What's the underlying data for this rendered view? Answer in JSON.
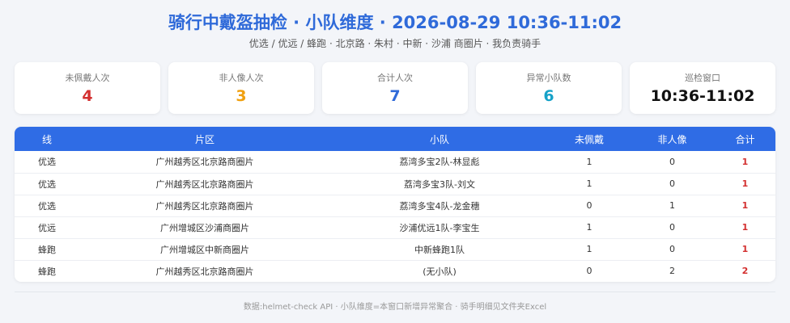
{
  "header": {
    "title": "骑行中戴盔抽检 · 小队维度 · 2026-08-29 10:36-11:02",
    "subtitle": "优选 / 优远 / 蜂跑 · 北京路 · 朱村 · 中新 · 沙浦 商圈片 · 我负责骑手"
  },
  "stats": [
    {
      "label": "未佩戴人次",
      "value": "4",
      "color": "#d32f2f"
    },
    {
      "label": "非人像人次",
      "value": "3",
      "color": "#f0a010"
    },
    {
      "label": "合计人次",
      "value": "7",
      "color": "#2f6ad9"
    },
    {
      "label": "异常小队数",
      "value": "6",
      "color": "#17a2c8"
    },
    {
      "label": "巡检窗口",
      "value": "10:36-11:02",
      "color": "#111111"
    }
  ],
  "table": {
    "headers": [
      "线",
      "片区",
      "小队",
      "未佩戴",
      "非人像",
      "合计"
    ],
    "rows": [
      [
        "优选",
        "广州越秀区北京路商圈片",
        "荔湾多宝2队-林显彪",
        "1",
        "0",
        "1"
      ],
      [
        "优选",
        "广州越秀区北京路商圈片",
        "荔湾多宝3队-刘文",
        "1",
        "0",
        "1"
      ],
      [
        "优选",
        "广州越秀区北京路商圈片",
        "荔湾多宝4队-龙金穗",
        "0",
        "1",
        "1"
      ],
      [
        "优远",
        "广州增城区沙浦商圈片",
        "沙浦优远1队-李宝生",
        "1",
        "0",
        "1"
      ],
      [
        "蜂跑",
        "广州增城区中新商圈片",
        "中新蜂跑1队",
        "1",
        "0",
        "1"
      ],
      [
        "蜂跑",
        "广州越秀区北京路商圈片",
        "(无小队)",
        "0",
        "2",
        "2"
      ]
    ]
  },
  "footer": {
    "text": "数据:helmet-check API · 小队维度=本窗口新增异常聚合 · 骑手明细见文件夹Excel"
  }
}
